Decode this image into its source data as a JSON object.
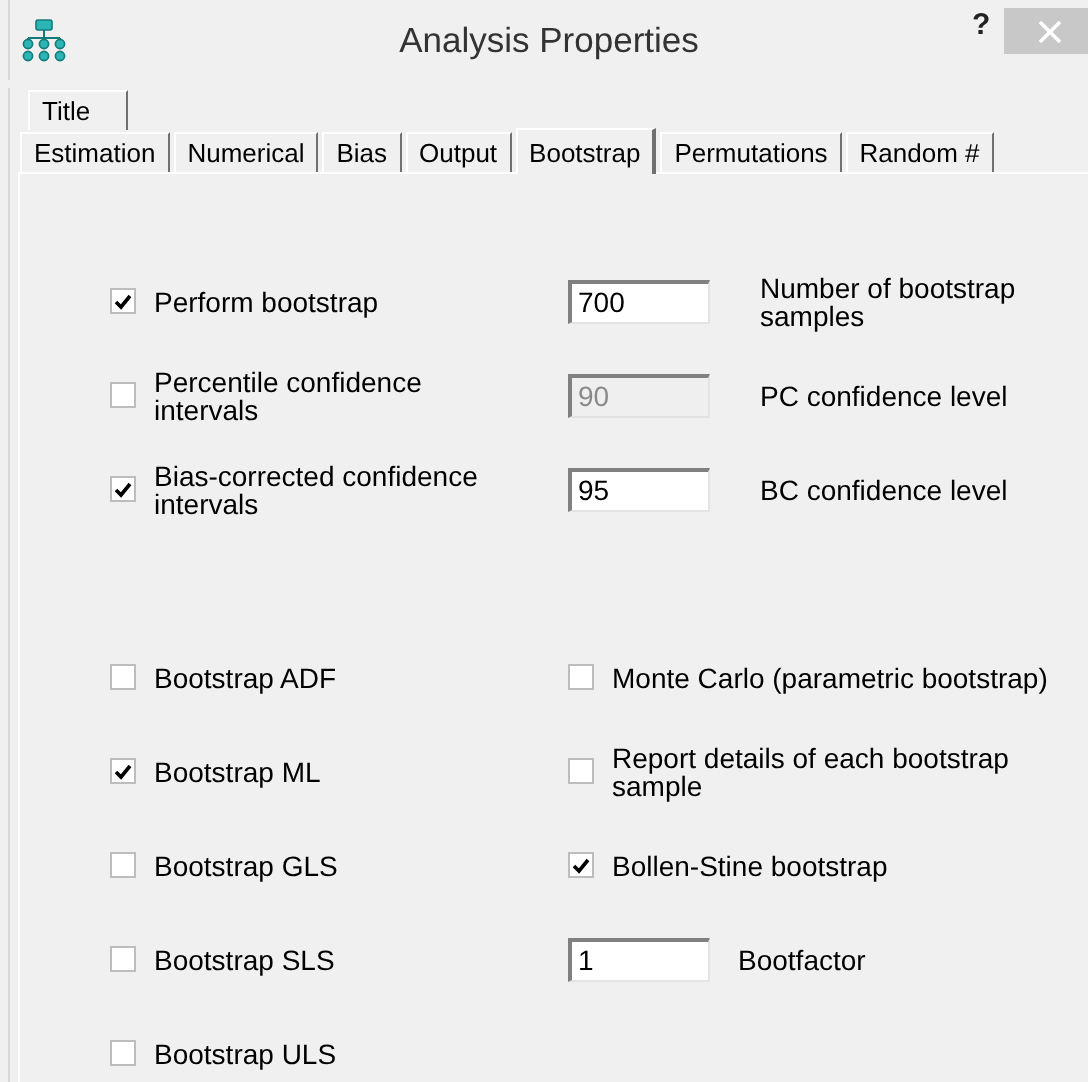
{
  "window": {
    "title": "Analysis Properties",
    "help": "?"
  },
  "tab_rows": [
    [
      {
        "label": "Title",
        "selected": false
      }
    ],
    [
      {
        "label": "Estimation",
        "selected": false
      },
      {
        "label": "Numerical",
        "selected": false
      },
      {
        "label": "Bias",
        "selected": false
      },
      {
        "label": "Output",
        "selected": false
      },
      {
        "label": "Bootstrap",
        "selected": true
      },
      {
        "label": "Permutations",
        "selected": false
      },
      {
        "label": "Random #",
        "selected": false
      }
    ]
  ],
  "confidence_options": [
    {
      "label": "Perform bootstrap",
      "checked": true,
      "field": {
        "value": "700",
        "disabled": false
      },
      "field_label": "Number of bootstrap samples"
    },
    {
      "label": "Percentile confidence intervals",
      "checked": false,
      "field": {
        "value": "90",
        "disabled": true
      },
      "field_label": "PC confidence level"
    },
    {
      "label": "Bias-corrected confidence intervals",
      "checked": true,
      "field": {
        "value": "95",
        "disabled": false
      },
      "field_label": "BC confidence level"
    }
  ],
  "method_options": [
    {
      "label": "Bootstrap ADF",
      "checked": false
    },
    {
      "label": "Bootstrap ML",
      "checked": true
    },
    {
      "label": "Bootstrap GLS",
      "checked": false
    },
    {
      "label": "Bootstrap SLS",
      "checked": false
    },
    {
      "label": "Bootstrap ULS",
      "checked": false
    }
  ],
  "other_options": [
    {
      "kind": "checkbox",
      "label": "Monte Carlo (parametric bootstrap)",
      "checked": false
    },
    {
      "kind": "checkbox",
      "label": "Report details of each bootstrap sample",
      "checked": false
    },
    {
      "kind": "checkbox",
      "label": "Bollen-Stine bootstrap",
      "checked": true
    },
    {
      "kind": "field",
      "field": {
        "value": "1"
      },
      "field_label": "Bootfactor"
    }
  ]
}
